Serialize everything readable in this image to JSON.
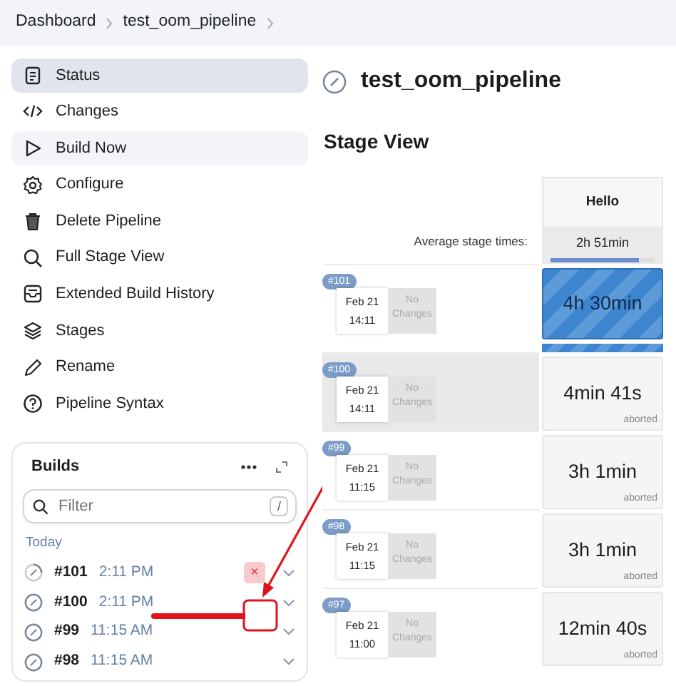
{
  "breadcrumb": [
    {
      "label": "Dashboard"
    },
    {
      "label": "test_oom_pipeline"
    }
  ],
  "sidebar": {
    "items": [
      {
        "label": "Status",
        "selected": true,
        "hovered": false
      },
      {
        "label": "Changes",
        "selected": false,
        "hovered": false
      },
      {
        "label": "Build Now",
        "selected": false,
        "hovered": true
      },
      {
        "label": "Configure",
        "selected": false,
        "hovered": false
      },
      {
        "label": "Delete Pipeline",
        "selected": false,
        "hovered": false
      },
      {
        "label": "Full Stage View",
        "selected": false,
        "hovered": false
      },
      {
        "label": "Extended Build History",
        "selected": false,
        "hovered": false
      },
      {
        "label": "Stages",
        "selected": false,
        "hovered": false
      },
      {
        "label": "Rename",
        "selected": false,
        "hovered": false
      },
      {
        "label": "Pipeline Syntax",
        "selected": false,
        "hovered": false
      }
    ]
  },
  "builds": {
    "title": "Builds",
    "filter": {
      "placeholder": "Filter",
      "shortcut": "/"
    },
    "group": "Today",
    "items": [
      {
        "number": "#101",
        "time": "2:11 PM",
        "cancel": "×",
        "running": true
      },
      {
        "number": "#100",
        "time": "2:11 PM",
        "running": false
      },
      {
        "number": "#99",
        "time": "11:15 AM",
        "running": false
      },
      {
        "number": "#98",
        "time": "11:15 AM",
        "running": false
      }
    ]
  },
  "page": {
    "title": "test_oom_pipeline",
    "section": "Stage View"
  },
  "stage_view": {
    "stage": "Hello",
    "average_label": "Average stage times:",
    "average": {
      "text": "2h 51min",
      "level": 0.85
    },
    "rows": [
      {
        "badge": "#101",
        "date": "Feb 21",
        "time": "14:11",
        "changes": "No Changes",
        "duration": "4h 30min",
        "kind": "running",
        "level": 1,
        "highlighted": false
      },
      {
        "badge": "#100",
        "date": "Feb 21",
        "time": "14:11",
        "changes": "No Changes",
        "duration": "4min 41s",
        "status": "aborted",
        "kind": "aborted",
        "highlighted": true
      },
      {
        "badge": "#99",
        "date": "Feb 21",
        "time": "11:15",
        "changes": "No Changes",
        "duration": "3h 1min",
        "status": "aborted",
        "kind": "aborted",
        "highlighted": false
      },
      {
        "badge": "#98",
        "date": "Feb 21",
        "time": "11:15",
        "changes": "No Changes",
        "duration": "3h 1min",
        "status": "aborted",
        "kind": "aborted",
        "highlighted": false
      },
      {
        "badge": "#97",
        "date": "Feb 21",
        "time": "11:00",
        "changes": "No Changes",
        "duration": "12min 40s",
        "status": "aborted",
        "kind": "aborted",
        "highlighted": false
      }
    ]
  }
}
